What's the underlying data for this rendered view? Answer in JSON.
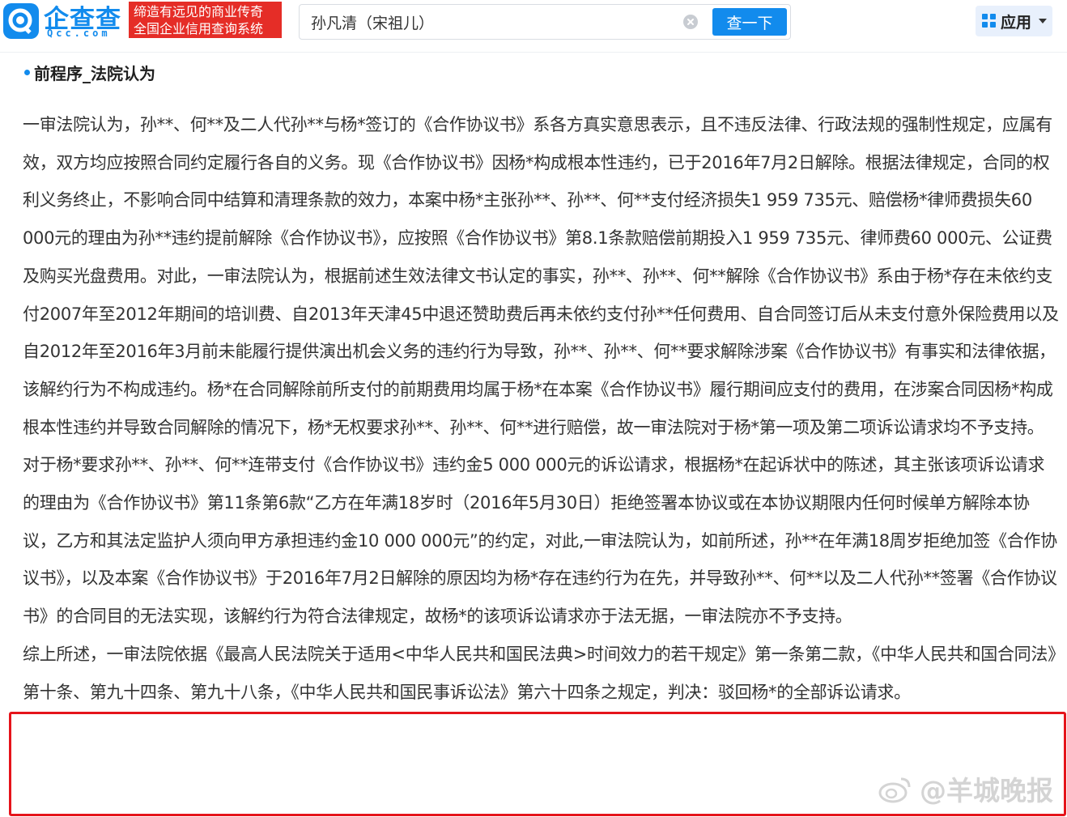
{
  "header": {
    "logo_text": "企查查",
    "logo_domain": "Qcc.com",
    "slogan_line1": "缔造有远见的商业传奇",
    "slogan_line2": "全国企业信用查询系统",
    "search_value": "孙凡清（宋祖儿）",
    "search_button": "查一下",
    "apps_label": "应用"
  },
  "colors": {
    "brand": "#128bed",
    "slogan_bg": "#e52d27",
    "highlight_border": "#e5141b"
  },
  "section": {
    "title": "前程序_法院认为"
  },
  "paragraphs": [
    "一审法院认为，孙**、何**及二人代孙**与杨*签订的《合作协议书》系各方真实意思表示，且不违反法律、行政法规的强制性规定，应属有效，双方均应按照合同约定履行各自的义务。现《合作协议书》因杨*构成根本性违约，已于2016年7月2日解除。根据法律规定，合同的权利义务终止，不影响合同中结算和清理条款的效力，本案中杨*主张孙**、孙**、何**支付经济损失1 959 735元、赔偿杨*律师费损失60 000元的理由为孙**违约提前解除《合作协议书》，应按照《合作协议书》第8.1条款赔偿前期投入1 959 735元、律师费60 000元、公证费及购买光盘费用。对此，一审法院认为，根据前述生效法律文书认定的事实，孙**、孙**、何**解除《合作协议书》系由于杨*存在未依约支付2007年至2012年期间的培训费、自2013年天津45中退还赞助费后再未依约支付孙**任何费用、自合同签订后从未支付意外保险费用以及自2012年至2016年3月前未能履行提供演出机会义务的违约行为导致，孙**、孙**、何**要求解除涉案《合作协议书》有事实和法律依据，该解约行为不构成违约。杨*在合同解除前所支付的前期费用均属于杨*在本案《合作协议书》履行期间应支付的费用，在涉案合同因杨*构成根本性违约并导致合同解除的情况下，杨*无权要求孙**、孙**、何**进行赔偿，故一审法院对于杨*第一项及第二项诉讼请求均不予支持。",
    "对于杨*要求孙**、孙**、何**连带支付《合作协议书》违约金5 000 000元的诉讼请求，根据杨*在起诉状中的陈述，其主张该项诉讼请求的理由为《合作协议书》第11条第6款“乙方在年满18岁时（2016年5月30日）拒绝签署本协议或在本协议期限内任何时候单方解除本协议，乙方和其法定监护人须向甲方承担违约金10 000 000元”的约定，对此,一审法院认为，如前所述，孙**在年满18周岁拒绝加签《合作协议书》，以及本案《合作协议书》于2016年7月2日解除的原因均为杨*存在违约行为在先，并导致孙**、何**以及二人代孙**签署《合作协议书》的合同目的无法实现，该解约行为符合法律规定，故杨*的该项诉讼请求亦于法无据，一审法院亦不予支持。",
    "综上所述，一审法院依据《最高人民法院关于适用<中华人民共和国民法典>时间效力的若干规定》第一条第二款，《中华人民共和国合同法》第十条、第九十四条、第九十八条，《中华人民共和国民事诉讼法》第六十四条之规定，判决：驳回杨*的全部诉讼请求。"
  ],
  "watermark": "@羊城晚报"
}
